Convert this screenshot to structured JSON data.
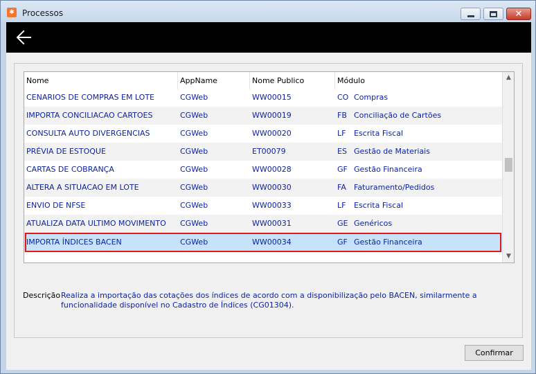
{
  "window": {
    "title": "Processos",
    "app_icon_glyph": "✱"
  },
  "grid": {
    "columns": [
      "Nome",
      "AppName",
      "Nome Publico",
      "Módulo"
    ],
    "rows": [
      {
        "nome": "CENARIOS DE COMPRAS EM LOTE",
        "app": "CGWeb",
        "publico": "WW00015",
        "mod_code": "CO",
        "mod_name": "Compras"
      },
      {
        "nome": "IMPORTA CONCILIACAO CARTOES",
        "app": "CGWeb",
        "publico": "WW00019",
        "mod_code": "FB",
        "mod_name": "Conciliação de Cartões"
      },
      {
        "nome": "CONSULTA AUTO DIVERGENCIAS",
        "app": "CGWeb",
        "publico": "WW00020",
        "mod_code": "LF",
        "mod_name": "Escrita Fiscal"
      },
      {
        "nome": "PRÉVIA DE ESTOQUE",
        "app": "CGWeb",
        "publico": "ET00079",
        "mod_code": "ES",
        "mod_name": "Gestão de Materiais"
      },
      {
        "nome": "CARTAS DE COBRANÇA",
        "app": "CGWeb",
        "publico": "WW00028",
        "mod_code": "GF",
        "mod_name": "Gestão Financeira"
      },
      {
        "nome": "ALTERA A SITUACAO EM LOTE",
        "app": "CGWeb",
        "publico": "WW00030",
        "mod_code": "FA",
        "mod_name": "Faturamento/Pedidos"
      },
      {
        "nome": "ENVIO DE NFSE",
        "app": "CGWeb",
        "publico": "WW00033",
        "mod_code": "LF",
        "mod_name": "Escrita Fiscal"
      },
      {
        "nome": "ATUALIZA DATA ULTIMO MOVIMENTO",
        "app": "CGWeb",
        "publico": "WW00031",
        "mod_code": "GE",
        "mod_name": "Genéricos"
      },
      {
        "nome": "IMPORTA ÍNDICES BACEN",
        "app": "CGWeb",
        "publico": "WW00034",
        "mod_code": "GF",
        "mod_name": "Gestão Financeira",
        "selected": true
      }
    ]
  },
  "description": {
    "label": "Descrição",
    "text": "Realiza a importação das cotações dos índices de acordo com a disponibilização pelo BACEN, similarmente a funcionalidade disponível no Cadastro de Índices (CG01304)."
  },
  "buttons": {
    "confirm_label": "Confirmar"
  },
  "icons": {
    "back": "arrow-left-icon",
    "minimize": "minimize-icon",
    "maximize": "maximize-icon",
    "close": "close-icon"
  }
}
